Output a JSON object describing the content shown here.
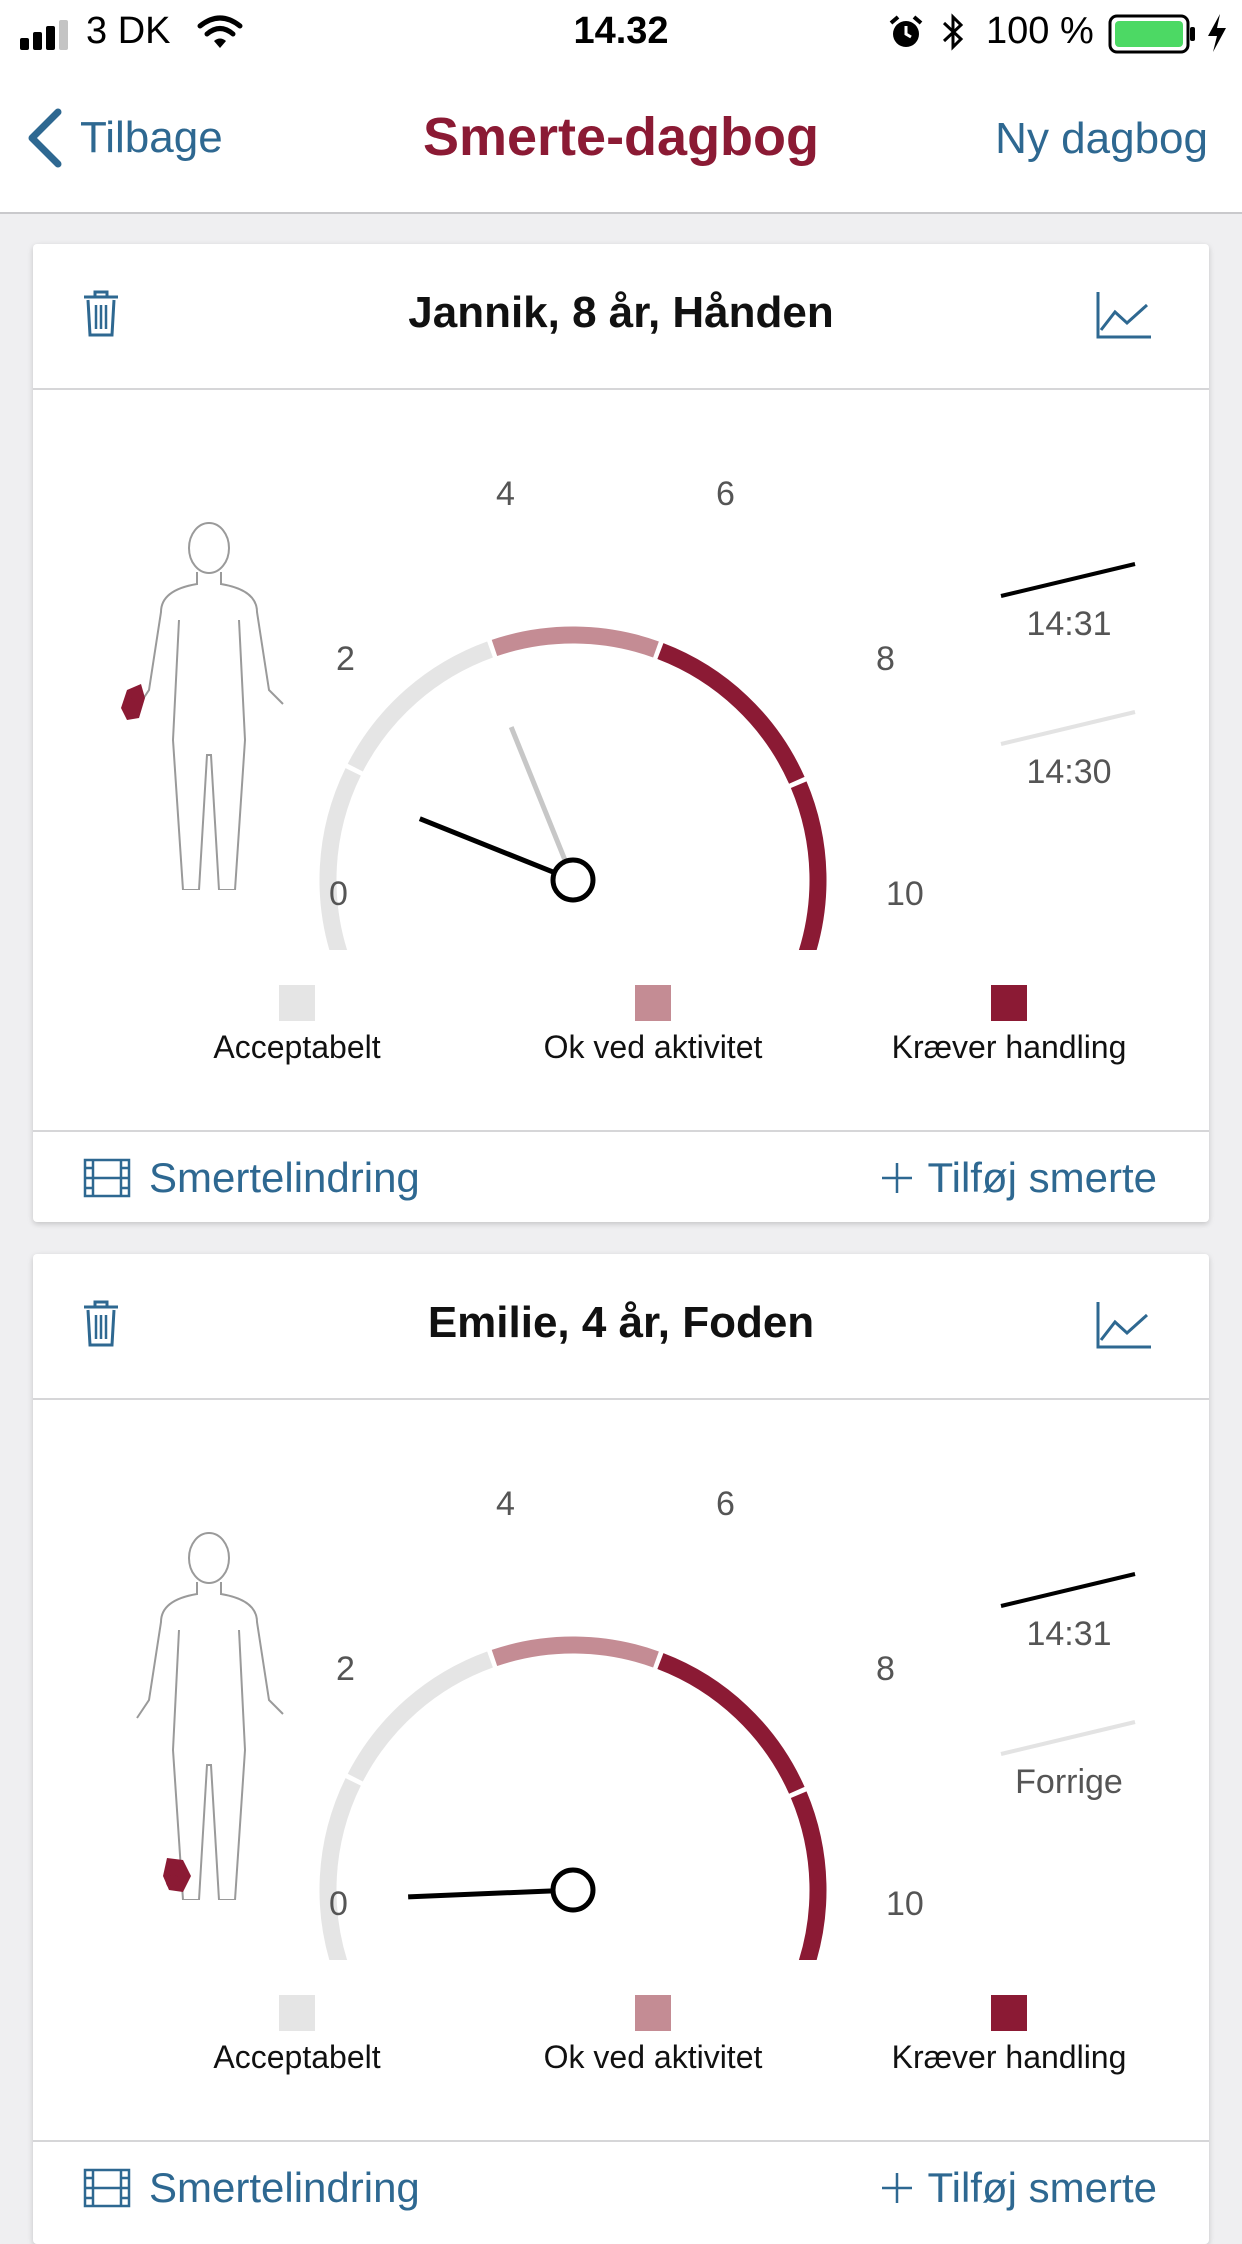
{
  "status_bar": {
    "carrier": "3 DK",
    "time": "14.32",
    "battery": "100 %"
  },
  "nav": {
    "back_label": "Tilbage",
    "title": "Smerte-dagbog",
    "new_label": "Ny dagbog"
  },
  "colors": {
    "accent": "#2e6891",
    "brand": "#8b1a34",
    "acceptable": "#e5e5e5",
    "ok_activity": "#c48c94",
    "action": "#8b1a34"
  },
  "legend": [
    {
      "label": "Acceptabelt",
      "color": "#e5e5e5"
    },
    {
      "label": "Ok ved aktivitet",
      "color": "#c48c94"
    },
    {
      "label": "Kræver handling",
      "color": "#8b1a34"
    }
  ],
  "scale_labels": [
    "0",
    "2",
    "4",
    "6",
    "8",
    "10"
  ],
  "footer": {
    "relief_label": "Smertelindring",
    "add_label": "Tilføj smerte"
  },
  "cards": [
    {
      "title": "Jannik, 8 år, Hånden",
      "body_region": "hand",
      "current_value": 1.9,
      "previous_value": 4.0,
      "history": [
        {
          "time": "14:31"
        },
        {
          "time": "14:30"
        }
      ]
    },
    {
      "title": "Emilie, 4 år, Foden",
      "body_region": "foot",
      "current_value": 0.8,
      "previous_value": null,
      "history": [
        {
          "time": "14:31"
        },
        {
          "time": "Forrige"
        }
      ]
    }
  ]
}
